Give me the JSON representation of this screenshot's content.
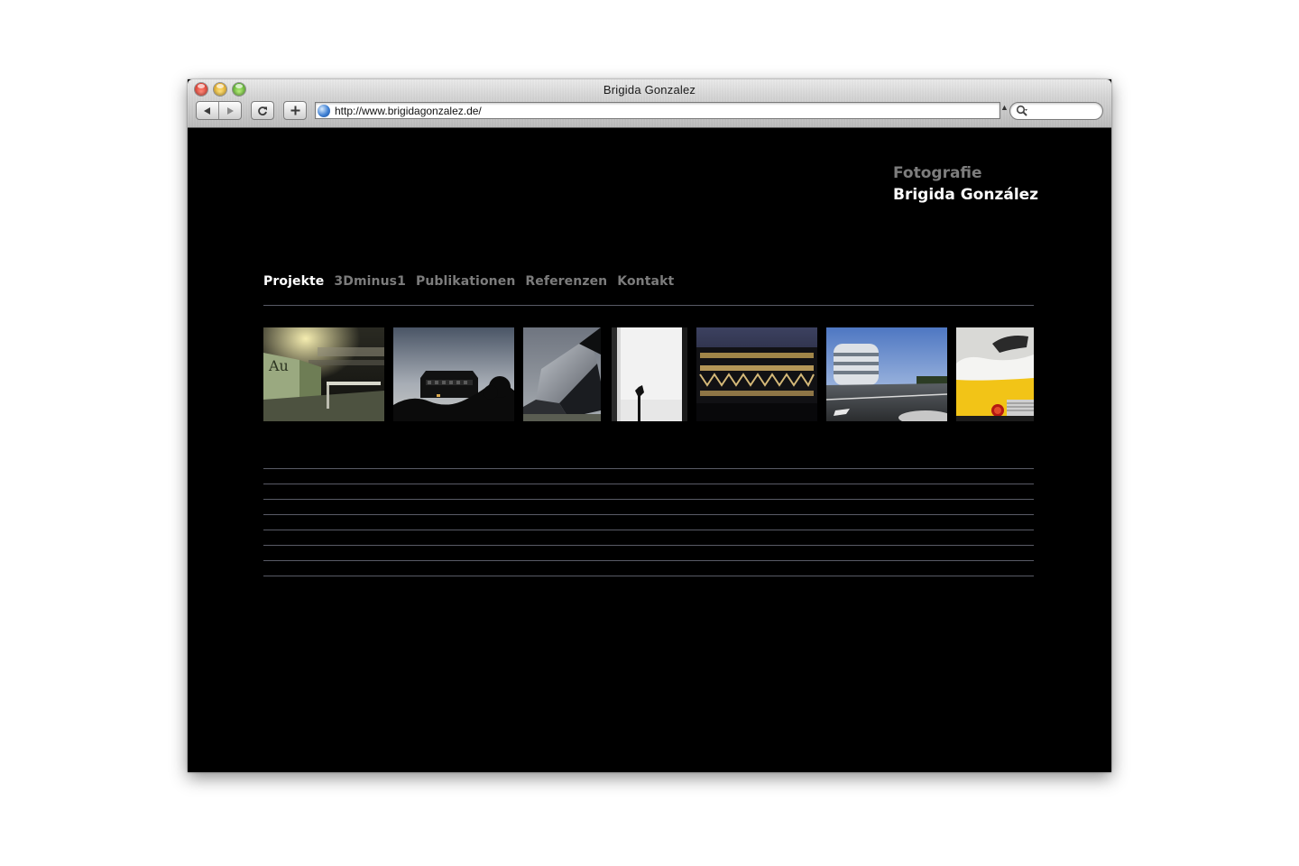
{
  "browser": {
    "window_title": "Brigida Gonzalez",
    "url": "http://www.brigidagonzalez.de/",
    "search_placeholder": ""
  },
  "site": {
    "brand_line1": "Fotografie",
    "brand_line2": "Brigida González",
    "nav": [
      {
        "label": "Projekte",
        "active": true
      },
      {
        "label": "3Dminus1",
        "active": false
      },
      {
        "label": "Publikationen",
        "active": false
      },
      {
        "label": "Referenzen",
        "active": false
      },
      {
        "label": "Kontakt",
        "active": false
      }
    ],
    "colors": {
      "background": "#000000",
      "nav_active": "#ffffff",
      "nav_inactive": "#7c7c7c",
      "rule": "#595b66"
    }
  }
}
